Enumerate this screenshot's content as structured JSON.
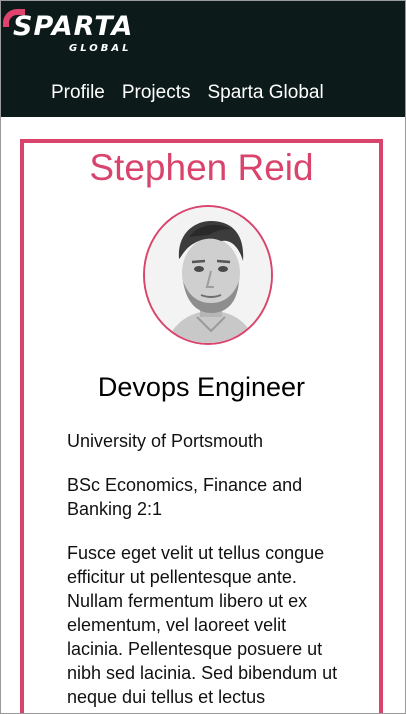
{
  "brand": {
    "logo_text": "SPARTA",
    "logo_subtext": "GLOBAL",
    "accent": "#d9446c",
    "navbar_bg": "#0d1a1a"
  },
  "nav": {
    "items": [
      "Profile",
      "Projects",
      "Sparta Global"
    ]
  },
  "profile": {
    "name": "Stephen Reid",
    "role": "Devops Engineer",
    "university": "University of Portsmouth",
    "degree": "BSc Economics, Finance and Banking 2:1",
    "description": "Fusce eget velit ut tellus congue efficitur ut pellentesque ante. Nullam fermentum libero ut ex elementum, vel laoreet velit lacinia. Pellentesque posuere ut nibh sed lacinia. Sed bibendum ut neque dui tellus et lectus"
  }
}
